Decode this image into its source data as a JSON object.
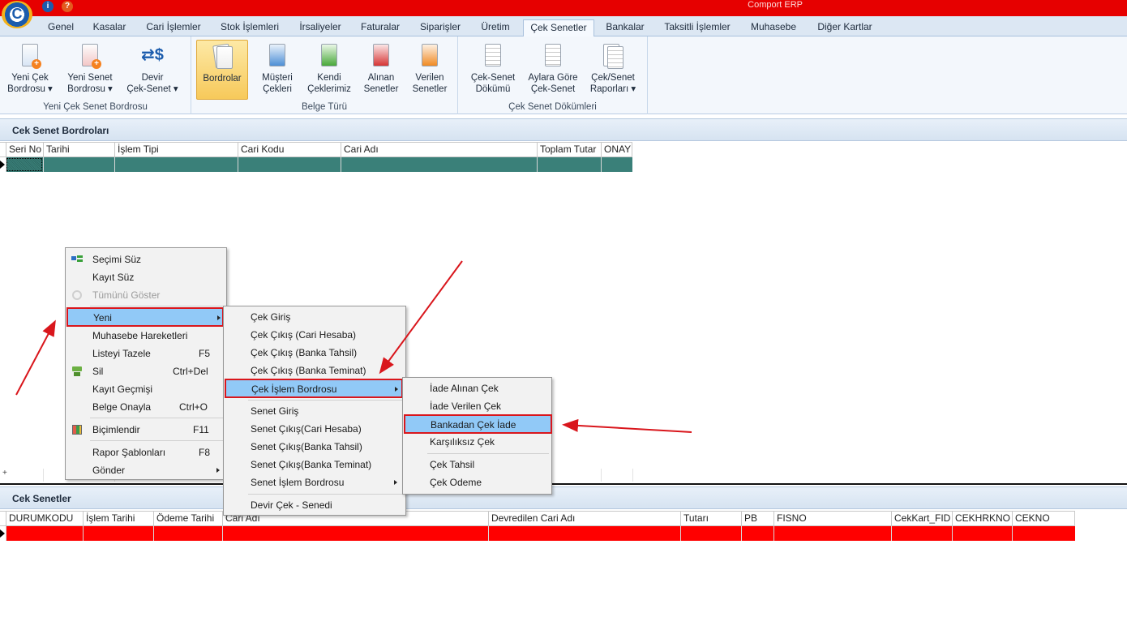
{
  "app": {
    "title": "Comport ERP",
    "logo_letter": "C"
  },
  "quick_access": [
    "info-icon",
    "help-icon"
  ],
  "tabs": [
    {
      "label": "Genel"
    },
    {
      "label": "Kasalar"
    },
    {
      "label": "Cari İşlemler"
    },
    {
      "label": "Stok İşlemleri"
    },
    {
      "label": "İrsaliyeler"
    },
    {
      "label": "Faturalar"
    },
    {
      "label": "Siparişler"
    },
    {
      "label": "Üretim"
    },
    {
      "label": "Çek Senetler",
      "active": true
    },
    {
      "label": "Bankalar"
    },
    {
      "label": "Taksitli İşlemler"
    },
    {
      "label": "Muhasebe"
    },
    {
      "label": "Diğer Kartlar"
    }
  ],
  "ribbon": {
    "groups": [
      {
        "label": "Yeni Çek Senet Bordrosu",
        "buttons": [
          {
            "line1": "Yeni Çek",
            "line2": "Bordrosu",
            "dropdown": true
          },
          {
            "line1": "Yeni Senet",
            "line2": "Bordrosu",
            "dropdown": true
          },
          {
            "line1": "Devir",
            "line2": "Çek-Senet",
            "dropdown": true
          }
        ]
      },
      {
        "label": "Belge Türü",
        "buttons": [
          {
            "line1": "Bordrolar",
            "line2": "",
            "selected": true
          },
          {
            "line1": "Müşteri",
            "line2": "Çekleri"
          },
          {
            "line1": "Kendi",
            "line2": "Çeklerimiz"
          },
          {
            "line1": "Alınan",
            "line2": "Senetler"
          },
          {
            "line1": "Verilen",
            "line2": "Senetler"
          }
        ]
      },
      {
        "label": "Çek Senet Dökümleri",
        "buttons": [
          {
            "line1": "Çek-Senet",
            "line2": "Dökümü"
          },
          {
            "line1": "Aylara Göre",
            "line2": "Çek-Senet"
          },
          {
            "line1": "Çek/Senet",
            "line2": "Raporları",
            "dropdown": true
          }
        ]
      }
    ],
    "dropdown_glyph": "▾"
  },
  "top_panel": {
    "title": "Cek Senet Bordroları",
    "columns": [
      "Seri No",
      "Tarihi",
      "İşlem Tipi",
      "Cari Kodu",
      "Cari Adı",
      "Toplam Tutar",
      "ONAY"
    ],
    "row_color": "#3a8079"
  },
  "bottom_panel": {
    "title": "Cek Senetler",
    "columns": [
      "DURUMKODU",
      "İşlem Tarihi",
      "Ödeme Tarihi",
      "Cari Adı",
      "Devredilen Cari Adı",
      "Tutarı",
      "PB",
      "FISNO",
      "CekKart_FID",
      "CEKHRKNO",
      "CEKNO"
    ],
    "row_color": "#ff0000"
  },
  "context_menu": {
    "items": [
      {
        "label": "Seçimi Süz",
        "shortcut": "",
        "icon": "filter-icon"
      },
      {
        "label": "Kayıt Süz",
        "shortcut": ""
      },
      {
        "label": "Tümünü Göster",
        "shortcut": "",
        "disabled": true,
        "icon": "clear-filter-icon"
      },
      {
        "label": "Yeni",
        "shortcut": "",
        "submenu": true,
        "highlighted": true
      },
      {
        "label": "Muhasebe Hareketleri",
        "shortcut": ""
      },
      {
        "label": "Listeyi Tazele",
        "shortcut": "F5"
      },
      {
        "label": "Sil",
        "shortcut": "Ctrl+Del",
        "icon": "delete-icon"
      },
      {
        "label": "Kayıt Geçmişi",
        "shortcut": ""
      },
      {
        "label": "Belge Onayla",
        "shortcut": "Ctrl+O"
      },
      {
        "label": "Biçimlendir",
        "shortcut": "F11",
        "icon": "format-icon"
      },
      {
        "label": "Rapor Şablonları",
        "shortcut": "F8"
      },
      {
        "label": "Gönder",
        "shortcut": "",
        "submenu": true
      }
    ]
  },
  "submenu_yeni": {
    "items": [
      {
        "label": "Çek Giriş"
      },
      {
        "label": "Çek Çıkış (Cari Hesaba)"
      },
      {
        "label": "Çek Çıkış (Banka Tahsil)"
      },
      {
        "label": "Çek Çıkış (Banka Teminat)"
      },
      {
        "label": "Çek İşlem Bordrosu",
        "submenu": true,
        "highlighted": true
      },
      {
        "label": "Senet Giriş"
      },
      {
        "label": "Senet Çıkış(Cari Hesaba)"
      },
      {
        "label": "Senet Çıkış(Banka Tahsil)"
      },
      {
        "label": "Senet Çıkış(Banka Teminat)"
      },
      {
        "label": "Senet İşlem Bordrosu",
        "submenu": true
      },
      {
        "label": "Devir Çek - Senedi"
      }
    ]
  },
  "submenu_cek_islem": {
    "items": [
      {
        "label": "İade Alınan Çek"
      },
      {
        "label": "İade Verilen Çek"
      },
      {
        "label": "Bankadan Çek İade",
        "highlighted": true
      },
      {
        "label": "Karşılıksız Çek"
      },
      {
        "label": "Çek Tahsil"
      },
      {
        "label": "Çek Odeme"
      }
    ]
  },
  "colors": {
    "accent_red": "#e60000",
    "highlight": "#91c9f7",
    "annotation": "#d9161c"
  }
}
